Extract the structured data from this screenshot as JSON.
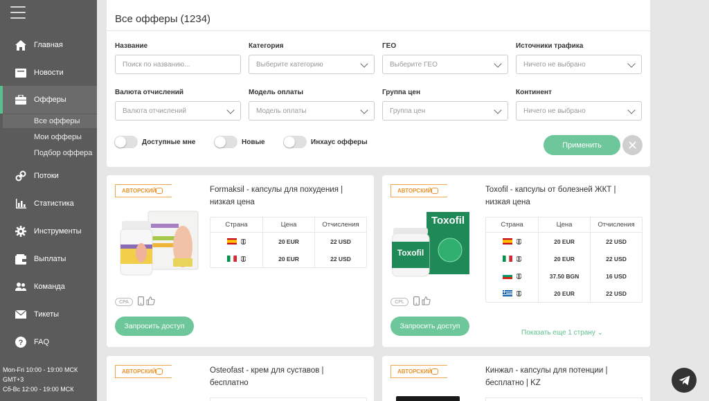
{
  "sidebar": {
    "nav": [
      {
        "label": "Главная",
        "icon": "home-icon"
      },
      {
        "label": "Новости",
        "icon": "news-icon"
      },
      {
        "label": "Офферы",
        "icon": "briefcase-icon"
      },
      {
        "label": "Потоки",
        "icon": "link-icon"
      },
      {
        "label": "Статистика",
        "icon": "bar-chart-icon"
      },
      {
        "label": "Инструменты",
        "icon": "gear-icon"
      },
      {
        "label": "Выплаты",
        "icon": "wallet-icon"
      },
      {
        "label": "Команда",
        "icon": "team-icon"
      },
      {
        "label": "Тикеты",
        "icon": "envelope-icon"
      },
      {
        "label": "FAQ",
        "icon": "question-icon"
      }
    ],
    "sub": [
      "Все офферы",
      "Мои офферы",
      "Подбор оффера"
    ],
    "support": [
      "Mon-Fri 10:00 - 19:00 МСК GMT+3",
      "Сб-Вс 12:00 - 19:00 МСК"
    ]
  },
  "filters": {
    "title": "Все офферы (1234)",
    "fields": [
      {
        "label": "Название",
        "placeholder": "Поиск по названию...",
        "dropdown": false
      },
      {
        "label": "Категория",
        "placeholder": "Выберите категорию",
        "dropdown": true
      },
      {
        "label": "ГЕО",
        "placeholder": "Выберите ГЕО",
        "dropdown": true
      },
      {
        "label": "Источники трафика",
        "placeholder": "Ничего не выбрано",
        "dropdown": true
      },
      {
        "label": "Валюта отчислений",
        "placeholder": "Валюта отчислений",
        "dropdown": true
      },
      {
        "label": "Модель оплаты",
        "placeholder": "Модель оплаты",
        "dropdown": true
      },
      {
        "label": "Группа цен",
        "placeholder": "Группа цен",
        "dropdown": true
      },
      {
        "label": "Континент",
        "placeholder": "Ничего не выбрано",
        "dropdown": true
      }
    ],
    "toggles": [
      "Доступные мне",
      "Новые",
      "Инхаус офферы"
    ],
    "apply_label": "Применить"
  },
  "table_headers": [
    "Страна",
    "Цена",
    "Отчисления"
  ],
  "badge_label": "АВТОРСКИЙ",
  "request_label": "Запросить доступ",
  "offers": [
    {
      "title": "Formaksil - капсулы для похудения | низкая цена",
      "model": "CPA",
      "rows": [
        {
          "country": "es",
          "price": "20 EUR",
          "payout": "22 USD"
        },
        {
          "country": "it",
          "price": "20 EUR",
          "payout": "22 USD"
        }
      ]
    },
    {
      "title": "Toxofil - капсулы от болезней ЖКТ | низкая цена",
      "model": "CPL",
      "product_name": "Toxofil",
      "rows": [
        {
          "country": "es",
          "price": "20 EUR",
          "payout": "22 USD"
        },
        {
          "country": "it",
          "price": "20 EUR",
          "payout": "22 USD"
        },
        {
          "country": "bg",
          "price": "37.50 BGN",
          "payout": "16 USD"
        },
        {
          "country": "gr",
          "price": "20 EUR",
          "payout": "22 USD"
        }
      ],
      "more_label": "Показать еще 1 страну"
    },
    {
      "title": "Osteofast - крем для суставов | бесплатно"
    },
    {
      "title": "Кинжал - капсулы для потенции | бесплатно | KZ"
    }
  ],
  "colors": {
    "accent": "#6dc79a",
    "sidebar": "#5b5b5b",
    "badge": "#e8942f"
  }
}
